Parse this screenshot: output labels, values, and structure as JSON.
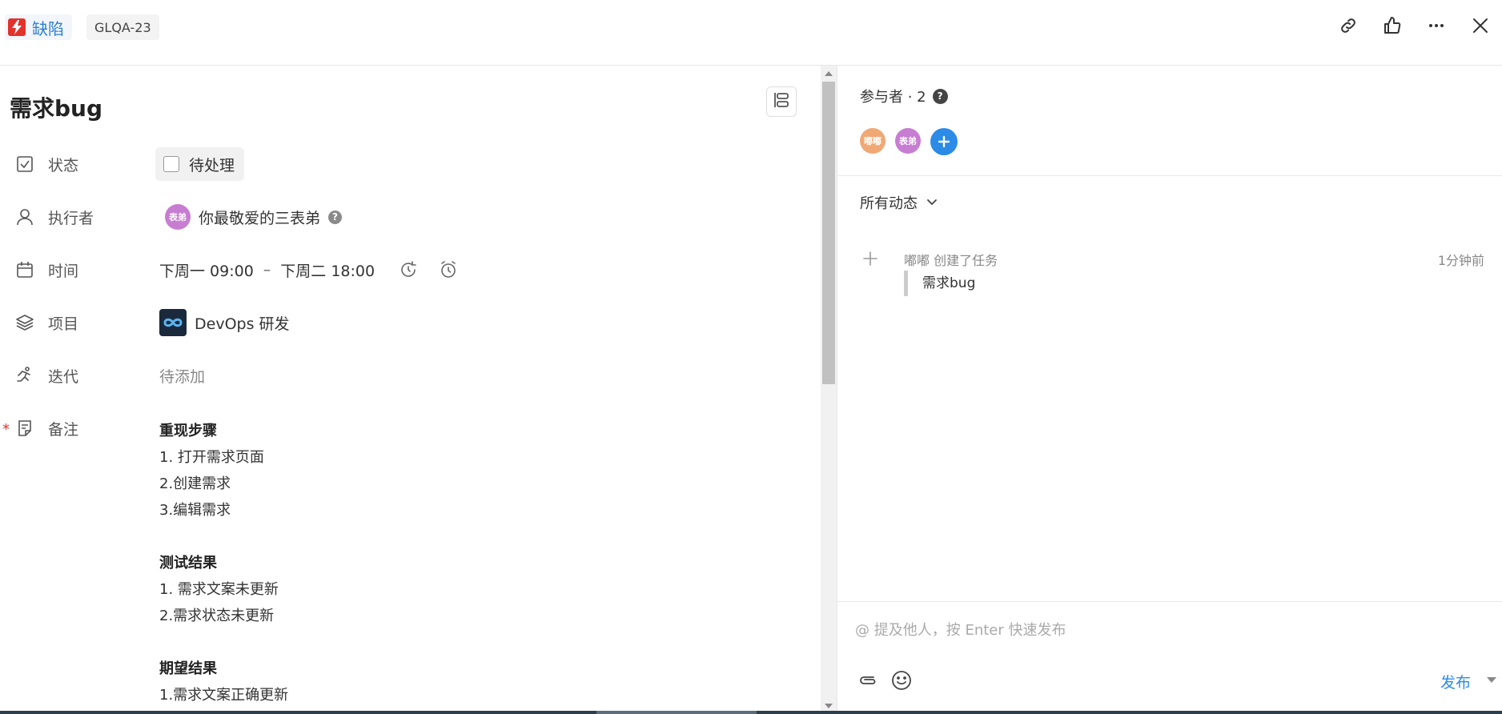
{
  "header": {
    "type_label": "缺陷",
    "task_id": "GLQA-23",
    "colors": {
      "type_icon": "#e2322c",
      "type_text": "#2d7fd3"
    }
  },
  "task": {
    "title": "需求bug",
    "fields": {
      "status": {
        "label": "状态",
        "value": "待处理"
      },
      "assignee": {
        "label": "执行者",
        "avatar_text": "表弟",
        "name": "你最敬爱的三表弟"
      },
      "time": {
        "label": "时间",
        "start": "下周一 09:00",
        "separator": "–",
        "end": "下周二 18:00"
      },
      "project": {
        "label": "项目",
        "value": "DevOps 研发"
      },
      "iteration": {
        "label": "迭代",
        "value": "待添加"
      },
      "notes": {
        "label": "备注",
        "required_mark": "*",
        "sections": [
          {
            "heading": "重现步骤",
            "lines": [
              "1. 打开需求页面",
              "2.创建需求",
              "3.编辑需求"
            ]
          },
          {
            "heading": "测试结果",
            "lines": [
              "1. 需求文案未更新",
              "2.需求状态未更新"
            ]
          },
          {
            "heading": "期望结果",
            "lines": [
              "1.需求文案正确更新"
            ]
          }
        ]
      }
    }
  },
  "sidebar": {
    "participants_label": "参与者 · 2",
    "participants": [
      {
        "text": "嘟嘟",
        "color": "#f0a875"
      },
      {
        "text": "表弟",
        "color": "#c77dd1"
      }
    ],
    "activity_filter": "所有动态",
    "activities": [
      {
        "actor": "嘟嘟",
        "action": "创建了任务",
        "time": "1分钟前",
        "quote": "需求bug"
      }
    ],
    "comment": {
      "placeholder": "@ 提及他人，按 Enter 快速发布",
      "publish_label": "发布"
    }
  },
  "colors": {
    "accent": "#2b8be6",
    "required": "#e2322c"
  }
}
